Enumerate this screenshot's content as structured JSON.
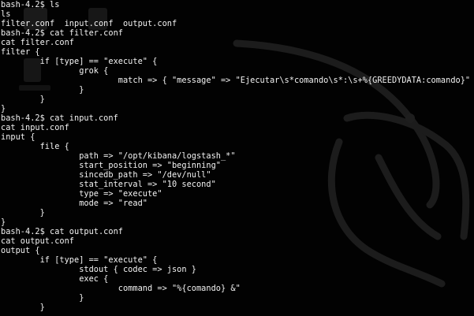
{
  "terminal": {
    "background_color": "#020202",
    "text_color": "#f2f2f2",
    "lines": [
      "bash-4.2$ ls",
      "ls",
      "filter.conf  input.conf  output.conf",
      "bash-4.2$ cat filter.conf",
      "cat filter.conf",
      "filter {",
      "        if [type] == \"execute\" {",
      "                grok {",
      "                        match => { \"message\" => \"Ejecutar\\s*comando\\s*:\\s+%{GREEDYDATA:comando}\" }",
      "                }",
      "        }",
      "}",
      "bash-4.2$ cat input.conf",
      "cat input.conf",
      "input {",
      "        file {",
      "                path => \"/opt/kibana/logstash_*\"",
      "                start_position => \"beginning\"",
      "                sincedb_path => \"/dev/null\"",
      "                stat_interval => \"10 second\"",
      "                type => \"execute\"",
      "                mode => \"read\"",
      "        }",
      "}",
      "bash-4.2$ cat output.conf",
      "cat output.conf",
      "output {",
      "        if [type] == \"execute\" {",
      "                stdout { codec => json }",
      "                exec {",
      "                        command => \"%{comando} &\"",
      "                }",
      "        }"
    ]
  }
}
